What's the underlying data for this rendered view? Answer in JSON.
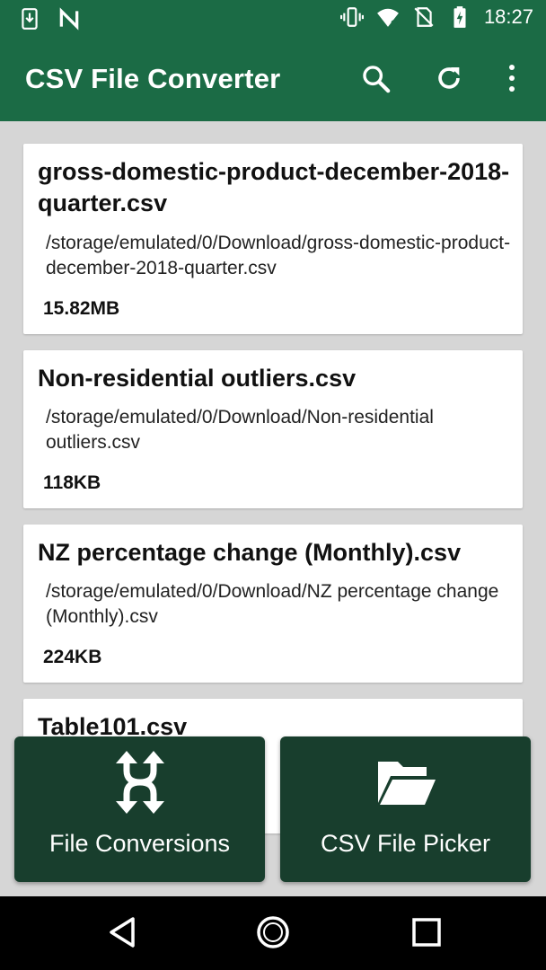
{
  "status_bar": {
    "time": "18:27",
    "icons": [
      "download-notification-icon",
      "n-notification-icon",
      "vibrate-icon",
      "wifi-icon",
      "no-sim-icon",
      "battery-charging-icon"
    ]
  },
  "app_bar": {
    "title": "CSV File Converter",
    "actions": [
      "search-icon",
      "refresh-icon",
      "more-vert-icon"
    ]
  },
  "files": [
    {
      "name": "gross-domestic-product-december-2018-quarter.csv",
      "path": "/storage/emulated/0/Download/gross-domestic-product-december-2018-quarter.csv",
      "size": "15.82MB"
    },
    {
      "name": "Non-residential outliers.csv",
      "path": "/storage/emulated/0/Download/Non-residential outliers.csv",
      "size": "118KB"
    },
    {
      "name": "NZ percentage change (Monthly).csv",
      "path": "/storage/emulated/0/Download/NZ percentage change (Monthly).csv",
      "size": "224KB"
    },
    {
      "name": "Table101.csv",
      "path": "",
      "size": ""
    }
  ],
  "buttons": {
    "file_conversions": "File Conversions",
    "csv_file_picker": "CSV File Picker"
  },
  "colors": {
    "primary": "#1b6b45",
    "button_bg": "#183e2d",
    "list_bg": "#d6d6d6"
  }
}
